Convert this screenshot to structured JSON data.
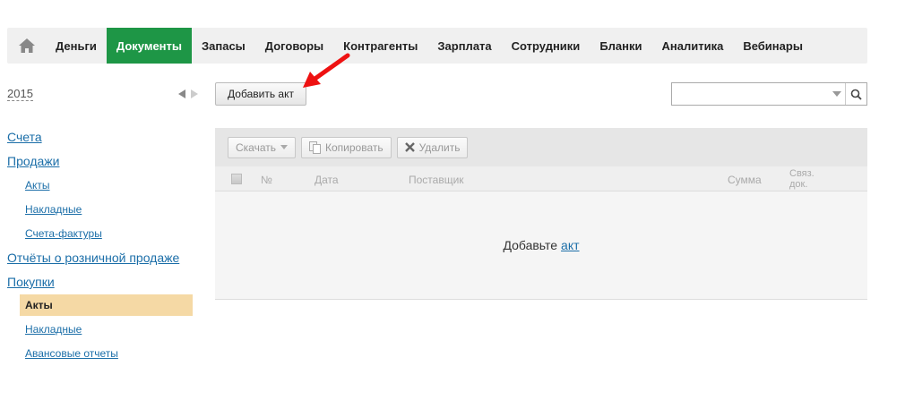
{
  "nav": {
    "home_icon": "home-icon",
    "items": [
      "Деньги",
      "Документы",
      "Запасы",
      "Договоры",
      "Контрагенты",
      "Зарплата",
      "Сотрудники",
      "Бланки",
      "Аналитика",
      "Вебинары"
    ],
    "active": "Документы",
    "accent_color": "#1e9646"
  },
  "sidebar": {
    "year": "2015",
    "links": {
      "invoices": "Счета",
      "sales": "Продажи",
      "sales_acts": "Акты",
      "sales_waybills": "Накладные",
      "sales_tax_invoices": "Счета-фактуры",
      "retail_reports": "Отчёты о розничной продаже",
      "purchases": "Покупки",
      "purchases_acts": "Акты",
      "purchases_waybills": "Накладные",
      "advance_reports": "Авансовые отчеты"
    },
    "active_color": "#f5d9a5"
  },
  "main": {
    "add_button": "Добавить акт",
    "search_placeholder": "",
    "toolbar": {
      "download": "Скачать",
      "copy": "Копировать",
      "delete": "Удалить"
    },
    "columns": {
      "number": "№",
      "date": "Дата",
      "supplier": "Поставщик",
      "amount": "Сумма",
      "linked_line1": "Связ.",
      "linked_line2": "док."
    },
    "empty": {
      "text": "Добавьте",
      "link": "акт"
    }
  }
}
